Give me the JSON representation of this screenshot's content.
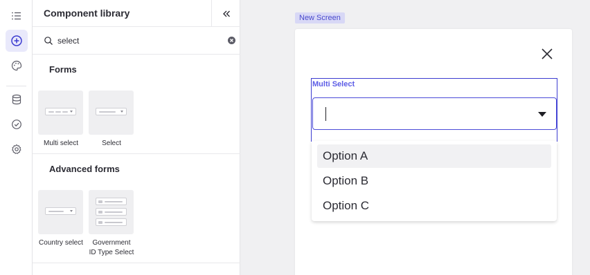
{
  "rail": {
    "items": [
      {
        "icon": "list-icon",
        "active": false
      },
      {
        "icon": "add-circle-icon",
        "active": true
      },
      {
        "icon": "palette-icon",
        "active": false
      },
      {
        "icon": "database-icon",
        "active": false
      },
      {
        "icon": "check-circle-icon",
        "active": false
      },
      {
        "icon": "gear-icon",
        "active": false
      }
    ]
  },
  "panel": {
    "title": "Component library",
    "search": {
      "value": "select",
      "placeholder": ""
    },
    "sections": [
      {
        "title": "Forms",
        "tiles": [
          {
            "label": "Multi select"
          },
          {
            "label": "Select"
          }
        ]
      },
      {
        "title": "Advanced forms",
        "tiles": [
          {
            "label": "Country select"
          },
          {
            "label": "Government ID Type Select"
          }
        ]
      }
    ]
  },
  "canvas": {
    "screen_tag": "New Screen",
    "field_label": "Multi Select",
    "options": [
      "Option A",
      "Option B",
      "Option C"
    ]
  },
  "colors": {
    "accent": "#4a4ad8",
    "accent_light": "#d8d8f6",
    "rail_active": "#e9e9fb"
  }
}
